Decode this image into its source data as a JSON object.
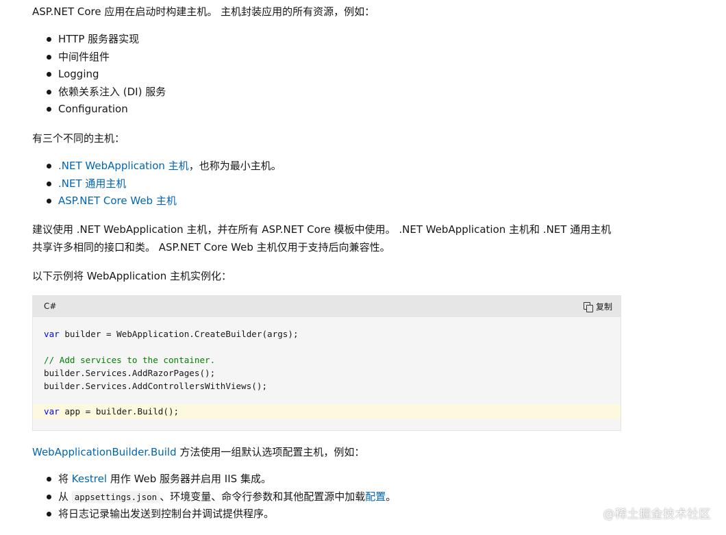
{
  "intro": "ASP.NET Core 应用在启动时构建主机。 主机封装应用的所有资源，例如：",
  "resources": [
    "HTTP 服务器实现",
    "中间件组件",
    "Logging",
    "依赖关系注入 (DI) 服务",
    "Configuration"
  ],
  "three_hosts_intro": "有三个不同的主机：",
  "hosts": [
    {
      "link": ".NET WebApplication 主机",
      "suffix": "，也称为最小主机。"
    },
    {
      "link": ".NET 通用主机",
      "suffix": ""
    },
    {
      "link": "ASP.NET Core Web 主机",
      "suffix": ""
    }
  ],
  "recommend_line1": "建议使用 .NET WebApplication 主机，并在所有 ASP.NET Core 模板中使用。 .NET WebApplication 主机和 .NET 通用主机",
  "recommend_line2": "共享许多相同的接口和类。 ASP.NET Core Web 主机仅用于支持后向兼容性。",
  "example_intro": "以下示例将 WebApplication 主机实例化：",
  "code": {
    "language": "C#",
    "copy_label": "复制",
    "line1_kw": "var",
    "line1_rest": " builder = WebApplication.CreateBuilder(args);",
    "line2_comment": "// Add services to the container.",
    "line3": "builder.Services.AddRazorPages();",
    "line4": "builder.Services.AddControllersWithViews();",
    "line5_kw": "var",
    "line5_rest": " app = builder.Build();"
  },
  "build_link": "WebApplicationBuilder.Build",
  "build_text": " 方法使用一组默认选项配置主机，例如：",
  "defaults": {
    "item1_prefix": "将 ",
    "item1_link": "Kestrel",
    "item1_suffix": " 用作 Web 服务器并启用 IIS 集成。",
    "item2_prefix": "从 ",
    "item2_code": "appsettings.json",
    "item2_mid": "、环境变量、命令行参数和其他配置源中加载",
    "item2_link": "配置",
    "item2_suffix": "。",
    "item3": "将日志记录输出发送到控制台并调试提供程序。"
  },
  "watermark": "@稀土掘金技术社区"
}
